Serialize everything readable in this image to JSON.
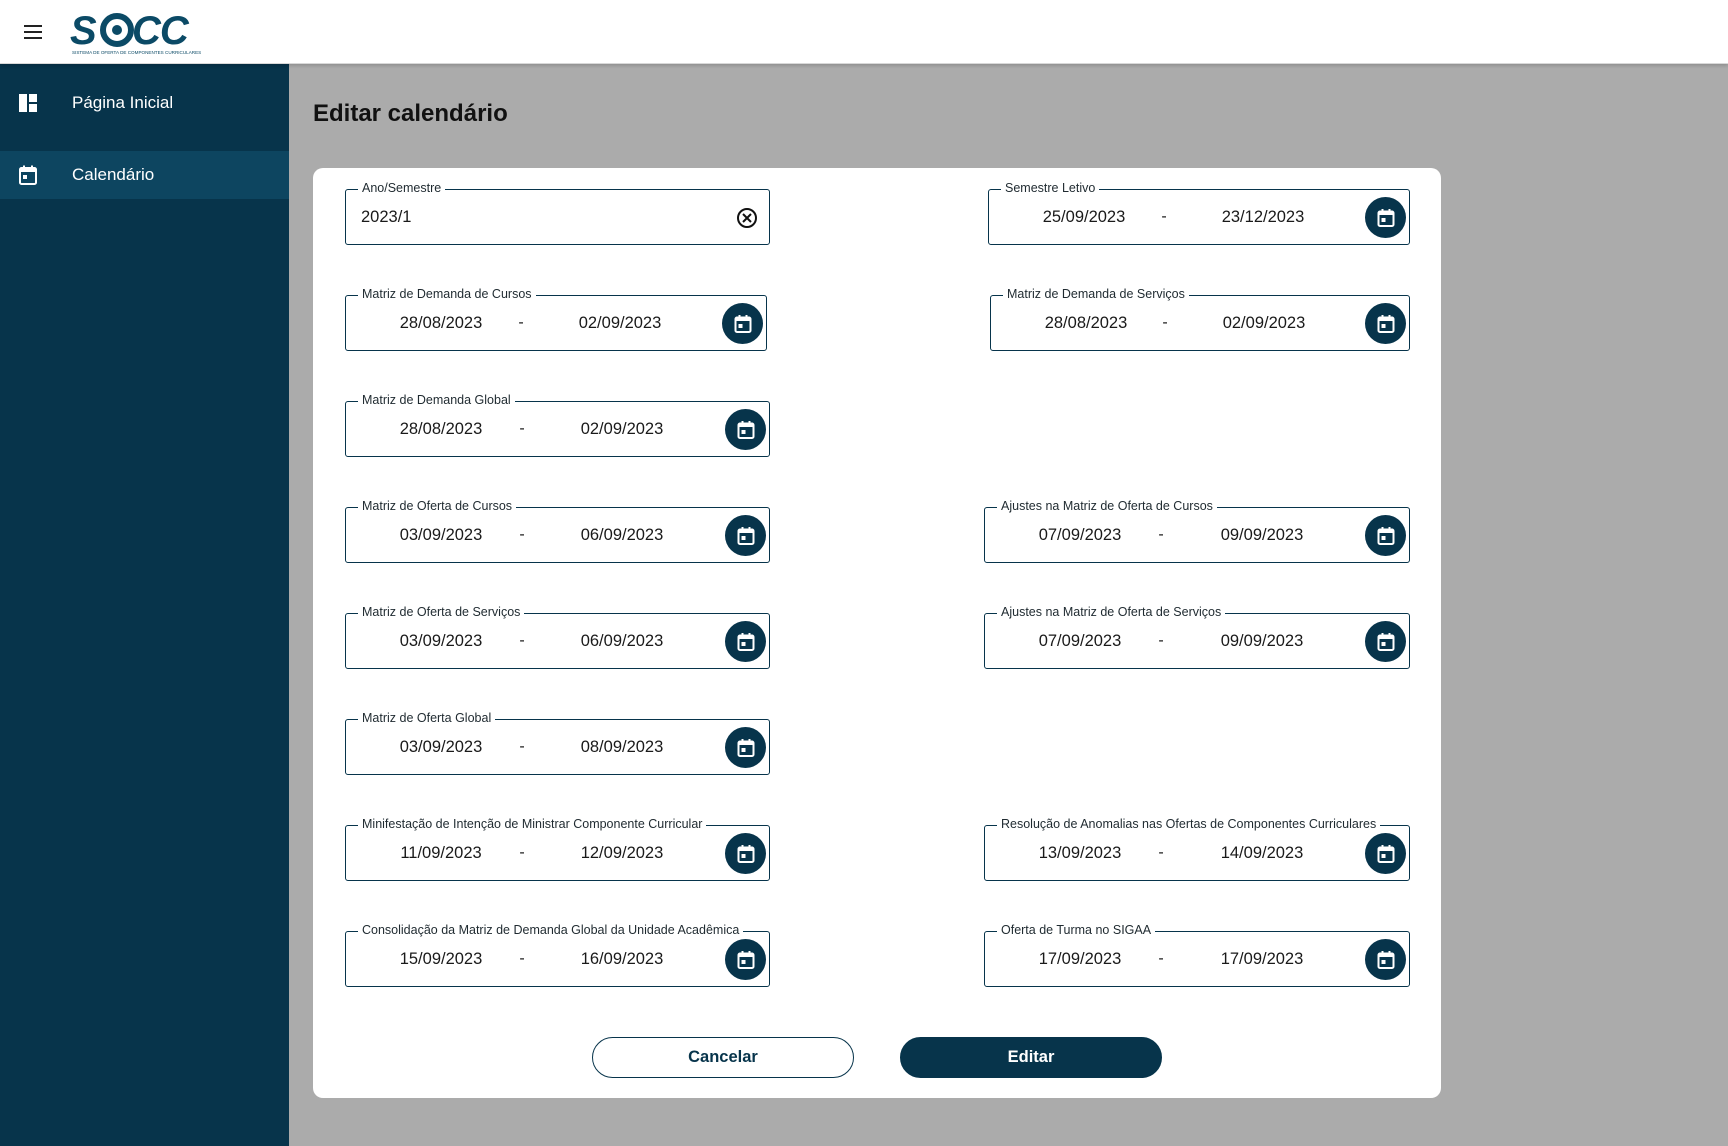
{
  "header": {
    "logo_alt": "SOCC",
    "logo_subtitle": "SISTEMA DE OFERTA DE COMPONENTES CURRICULARES"
  },
  "sidebar": {
    "items": [
      {
        "label": "Página Inicial",
        "icon": "dashboard-icon"
      },
      {
        "label": "Calendário",
        "icon": "calendar-icon",
        "active": true
      }
    ]
  },
  "page": {
    "title": "Editar calendário"
  },
  "form": {
    "ano_semestre": {
      "label": "Ano/Semestre",
      "value": "2023/1"
    },
    "semestre_letivo": {
      "label": "Semestre Letivo",
      "start": "25/09/2023",
      "end": "23/12/2023"
    },
    "demanda_cursos": {
      "label": "Matriz de Demanda de Cursos",
      "start": "28/08/2023",
      "end": "02/09/2023"
    },
    "demanda_servicos": {
      "label": "Matriz de Demanda de Serviços",
      "start": "28/08/2023",
      "end": "02/09/2023"
    },
    "demanda_global": {
      "label": "Matriz de Demanda Global",
      "start": "28/08/2023",
      "end": "02/09/2023"
    },
    "oferta_cursos": {
      "label": "Matriz de Oferta de Cursos",
      "start": "03/09/2023",
      "end": "06/09/2023"
    },
    "ajustes_oferta_cursos": {
      "label": "Ajustes na Matriz de Oferta de Cursos",
      "start": "07/09/2023",
      "end": "09/09/2023"
    },
    "oferta_servicos": {
      "label": "Matriz de Oferta de Serviços",
      "start": "03/09/2023",
      "end": "06/09/2023"
    },
    "ajustes_oferta_servicos": {
      "label": "Ajustes na Matriz de Oferta de Serviços",
      "start": "07/09/2023",
      "end": "09/09/2023"
    },
    "oferta_global": {
      "label": "Matriz de Oferta Global",
      "start": "03/09/2023",
      "end": "08/09/2023"
    },
    "intencao_ministrar": {
      "label": "Minifestação de Intenção de Ministrar Componente Curricular",
      "start": "11/09/2023",
      "end": "12/09/2023"
    },
    "resolucao_anomalias": {
      "label": "Resolução de Anomalias nas Ofertas de Componentes Curriculares",
      "start": "13/09/2023",
      "end": "14/09/2023"
    },
    "consolidacao": {
      "label": "Consolidação da Matriz de Demanda Global da Unidade Acadêmica",
      "start": "15/09/2023",
      "end": "16/09/2023"
    },
    "oferta_turma_sigaa": {
      "label": "Oferta de Turma no SIGAA",
      "start": "17/09/2023",
      "end": "17/09/2023"
    },
    "separator": "-"
  },
  "actions": {
    "cancel_label": "Cancelar",
    "edit_label": "Editar"
  },
  "colors": {
    "primary": "#07344b",
    "sidebar_active": "#0d4560",
    "background": "#ababab"
  }
}
